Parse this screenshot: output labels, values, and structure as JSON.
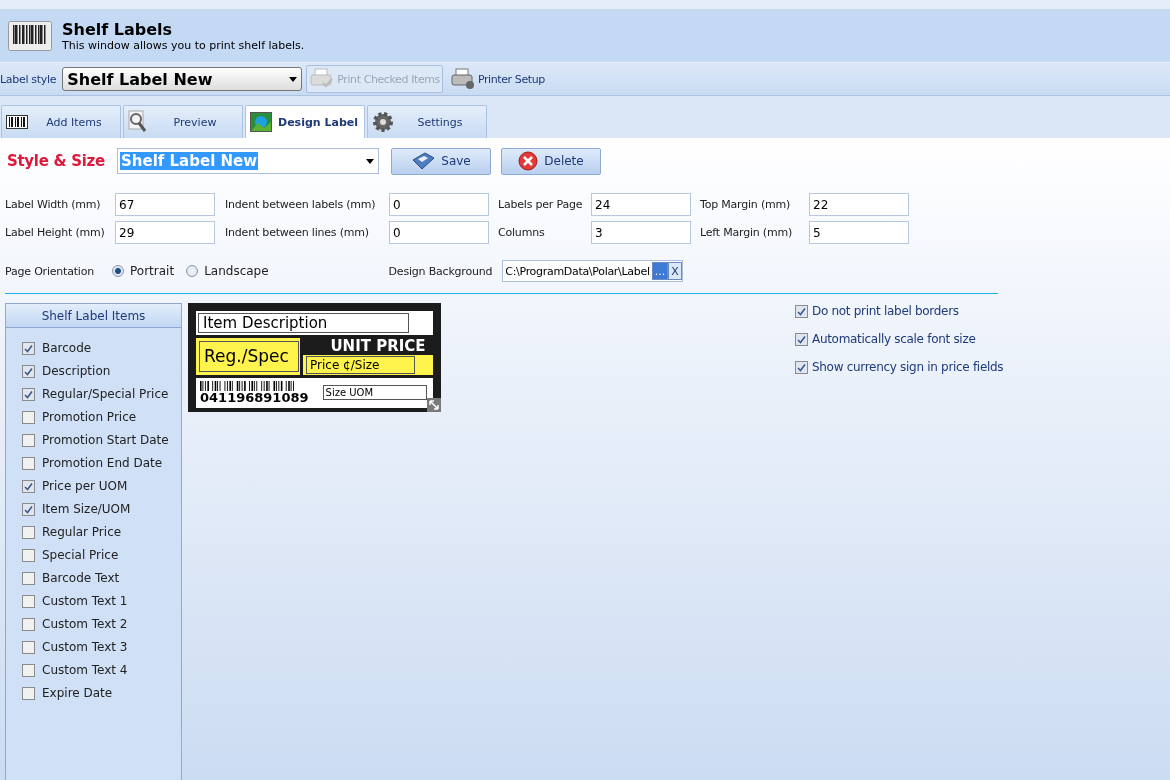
{
  "header": {
    "title": "Shelf Labels",
    "subtitle": "This window allows you to print shelf labels."
  },
  "toolbar": {
    "label": "Label style",
    "style_value": "Shelf Label New",
    "buttons": [
      {
        "label": "Print Checked Items",
        "disabled": true
      },
      {
        "label": "Printer Setup",
        "disabled": false
      }
    ]
  },
  "tabs": [
    {
      "label": "Add Items",
      "selected": false,
      "kind": "barcode"
    },
    {
      "label": "Preview",
      "selected": false,
      "kind": "preview"
    },
    {
      "label": "Design Label",
      "selected": true,
      "kind": "image"
    },
    {
      "label": "Settings",
      "selected": false,
      "kind": "gear"
    }
  ],
  "style_size": {
    "title": "Style & Size",
    "value": "Shelf Label New",
    "save": "Save",
    "delete": "Delete"
  },
  "fields": [
    {
      "label": "Label Width (mm)",
      "value": "67"
    },
    {
      "label": "Indent between labels (mm)",
      "value": "0"
    },
    {
      "label": "Labels per Page",
      "value": "24"
    },
    {
      "label": "Top Margin (mm)",
      "value": "22"
    },
    {
      "label": "Label Height (mm)",
      "value": "29"
    },
    {
      "label": "Indent between lines (mm)",
      "value": "0"
    },
    {
      "label": "Columns",
      "value": "3"
    },
    {
      "label": "Left Margin (mm)",
      "value": "5"
    }
  ],
  "orientation": {
    "label": "Page Orientation",
    "options": [
      {
        "label": "Portrait",
        "selected": true
      },
      {
        "label": "Landscape",
        "selected": false
      }
    ]
  },
  "design_background": {
    "label": "Design Background",
    "value": "C:\\ProgramData\\Polar\\Label",
    "browse": "...",
    "clear": "X"
  },
  "items_panel": {
    "title": "Shelf Label Items",
    "items": [
      {
        "label": "Barcode",
        "checked": true
      },
      {
        "label": "Description",
        "checked": true
      },
      {
        "label": "Regular/Special Price",
        "checked": true
      },
      {
        "label": "Promotion Price",
        "checked": false
      },
      {
        "label": "Promotion Start Date",
        "checked": false
      },
      {
        "label": "Promotion End Date",
        "checked": false
      },
      {
        "label": "Price per UOM",
        "checked": true
      },
      {
        "label": "Item Size/UOM",
        "checked": true
      },
      {
        "label": "Regular Price",
        "checked": false
      },
      {
        "label": "Special Price",
        "checked": false
      },
      {
        "label": "Barcode Text",
        "checked": false
      },
      {
        "label": "Custom Text 1",
        "checked": false
      },
      {
        "label": "Custom Text 2",
        "checked": false
      },
      {
        "label": "Custom Text 3",
        "checked": false
      },
      {
        "label": "Custom Text 4",
        "checked": false
      },
      {
        "label": "Expire Date",
        "checked": false
      }
    ]
  },
  "label_preview": {
    "description": "Item Description",
    "price": "Reg./Spec",
    "unit_price_title": "UNIT PRICE",
    "unit_price": "Price ¢/Size",
    "barcode_number": "041196891089",
    "size": "Size UOM"
  },
  "options": [
    {
      "label": "Do not print label borders",
      "checked": true
    },
    {
      "label": "Automatically scale font size",
      "checked": true
    },
    {
      "label": "Show currency sign in price fields",
      "checked": true
    }
  ]
}
